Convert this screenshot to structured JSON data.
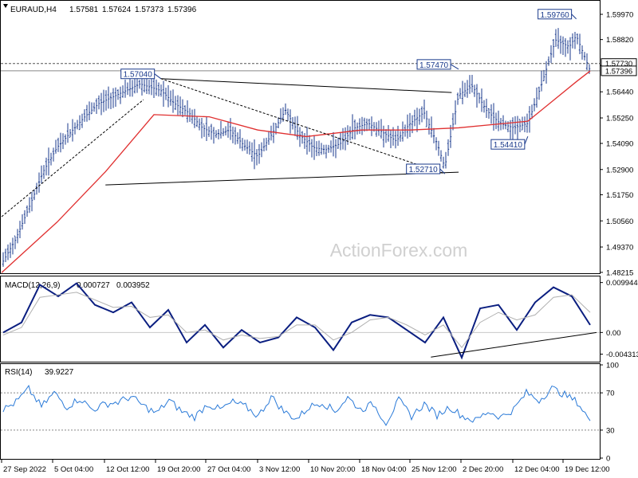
{
  "chart_data": [
    {
      "type": "line",
      "subtype": "candlestick-bars",
      "header": {
        "symbol": "EURAUD,H4",
        "ohlc": [
          "1.57581",
          "1.57624",
          "1.57373",
          "1.57396"
        ]
      },
      "watermark": "ActionForex.com",
      "y_axis_side": "right",
      "ylim": [
        1.4821,
        1.6055
      ],
      "yticks": [
        "1.59970",
        "1.58820",
        "1.57640",
        "1.56440",
        "1.55250",
        "1.54090",
        "1.52900",
        "1.51750",
        "1.50560",
        "1.49370",
        "1.48215"
      ],
      "price_box_labels": {
        "last_close": "1.57396",
        "horizontal_level": "1.57730"
      },
      "annotations": [
        {
          "text": "1.57040",
          "x": "20 Oct 2022",
          "y": 1.5704
        },
        {
          "text": "1.52710",
          "x": "30 Nov 2022",
          "y": 1.5271
        },
        {
          "text": "1.57470",
          "x": "2 Dec 2022",
          "y": 1.5747
        },
        {
          "text": "1.54410",
          "x": "12 Dec 2022",
          "y": 1.5441
        },
        {
          "text": "1.59760",
          "x": "19 Dec 2022",
          "y": 1.5976
        }
      ],
      "series": [
        {
          "name": "",
          "color": "#1a3a8c",
          "x": [
            "27 Sep",
            "29 Sep",
            "1 Oct",
            "3 Oct",
            "5 Oct",
            "7 Oct",
            "9 Oct",
            "11 Oct",
            "13 Oct",
            "15 Oct",
            "17 Oct",
            "19 Oct",
            "20 Oct",
            "22 Oct",
            "24 Oct",
            "26 Oct",
            "28 Oct",
            "30 Oct",
            "1 Nov",
            "3 Nov",
            "5 Nov",
            "7 Nov",
            "9 Nov",
            "11 Nov",
            "13 Nov",
            "15 Nov",
            "17 Nov",
            "19 Nov",
            "21 Nov",
            "23 Nov",
            "25 Nov",
            "27 Nov",
            "29 Nov",
            "30 Nov",
            "2 Dec",
            "4 Dec",
            "6 Dec",
            "8 Dec",
            "10 Dec",
            "12 Dec",
            "14 Dec",
            "16 Dec",
            "18 Dec",
            "19 Dec",
            "20 Dec",
            "21 Dec"
          ],
          "values": [
            1.486,
            1.497,
            1.512,
            1.528,
            1.539,
            1.546,
            1.553,
            1.559,
            1.562,
            1.565,
            1.568,
            1.566,
            1.565,
            1.559,
            1.555,
            1.548,
            1.545,
            1.547,
            1.54,
            1.535,
            1.545,
            1.556,
            1.545,
            1.539,
            1.538,
            1.541,
            1.548,
            1.55,
            1.546,
            1.542,
            1.55,
            1.555,
            1.54,
            1.53,
            1.563,
            1.567,
            1.556,
            1.55,
            1.548,
            1.55,
            1.568,
            1.588,
            1.585,
            1.59,
            1.582,
            1.574
          ]
        },
        {
          "name": "",
          "color": "#e03030",
          "x": [
            "27 Sep",
            "5 Oct",
            "12 Oct",
            "19 Oct",
            "27 Oct",
            "3 Nov",
            "10 Nov",
            "18 Nov",
            "25 Nov",
            "2 Dec",
            "12 Dec",
            "19 Dec",
            "21 Dec"
          ],
          "values": [
            1.482,
            1.505,
            1.528,
            1.554,
            1.553,
            1.547,
            1.544,
            1.547,
            1.547,
            1.548,
            1.551,
            1.569,
            1.5739
          ]
        }
      ],
      "trendlines": [
        {
          "from": {
            "x": "20 Oct",
            "y": 1.5704
          },
          "to": {
            "x": "1 Dec",
            "y": 1.5641
          }
        },
        {
          "from": {
            "x": "12 Oct",
            "y": 1.522
          },
          "to": {
            "x": "2 Dec",
            "y": 1.5278
          }
        },
        {
          "from": {
            "x": "20 Oct",
            "y": 1.5704
          },
          "to": {
            "x": "30 Nov",
            "y": 1.5271
          }
        }
      ],
      "xticks": [
        "27 Sep 2022",
        "5 Oct 04:00",
        "12 Oct 12:00",
        "19 Oct 20:00",
        "27 Oct 04:00",
        "3 Nov 12:00",
        "10 Nov 20:00",
        "18 Nov 04:00",
        "25 Nov 12:00",
        "2 Dec 20:00",
        "12 Dec 04:00",
        "19 Dec 12:00"
      ]
    },
    {
      "type": "line",
      "header": {
        "name": "MACD(12,26,9)",
        "values": [
          "0.000727",
          "0.003952"
        ]
      },
      "ylim": [
        -0.0055,
        0.011
      ],
      "yticks": [
        "0.009944",
        "0.00",
        "-0.004313"
      ],
      "zero_label": "0.00",
      "series": [
        {
          "name": "",
          "color": "#0a1e80",
          "values": [
            -0.0,
            0.002,
            0.0095,
            0.0072,
            0.0098,
            0.0055,
            0.004,
            0.006,
            0.001,
            0.0045,
            -0.002,
            0.0015,
            -0.003,
            0.0005,
            -0.002,
            -0.001,
            0.003,
            0.001,
            -0.0035,
            0.002,
            0.0035,
            0.003,
            0.0005,
            -0.002,
            0.003,
            -0.005,
            0.0048,
            0.0055,
            0.0005,
            0.006,
            0.009,
            0.0072,
            0.0015
          ]
        },
        {
          "name": "",
          "color": "#b0b0b0",
          "values": [
            -0.0005,
            0.001,
            0.007,
            0.0075,
            0.008,
            0.0065,
            0.005,
            0.0052,
            0.003,
            0.0035,
            0.0,
            0.0005,
            -0.0015,
            -0.0005,
            -0.0012,
            -0.0008,
            0.0015,
            0.0015,
            -0.0015,
            0.0,
            0.0025,
            0.003,
            0.0015,
            -0.0005,
            0.0015,
            -0.003,
            0.002,
            0.004,
            0.0025,
            0.0035,
            0.007,
            0.0075,
            0.004
          ]
        }
      ],
      "trendlines": [
        {
          "from": {
            "x": "28 Nov",
            "y": -0.0049
          },
          "to": {
            "x": "21 Dec",
            "y": -0.0
          }
        }
      ]
    },
    {
      "type": "line",
      "header": {
        "name": "RSI(14)",
        "value": "39.9227"
      },
      "ylim": [
        0,
        100
      ],
      "yticks": [
        "100",
        "70",
        "30",
        "0"
      ],
      "levels": [
        70,
        30
      ],
      "series": [
        {
          "name": "",
          "color": "#2a7ad8",
          "values": [
            52,
            60,
            74,
            55,
            70,
            55,
            64,
            52,
            58,
            60,
            66,
            56,
            48,
            62,
            50,
            44,
            58,
            52,
            60,
            55,
            45,
            66,
            50,
            42,
            55,
            60,
            50,
            65,
            52,
            58,
            38,
            62,
            45,
            58,
            46,
            55,
            45,
            40,
            50,
            44,
            52,
            70,
            62,
            75,
            68,
            60,
            40
          ]
        }
      ]
    }
  ]
}
